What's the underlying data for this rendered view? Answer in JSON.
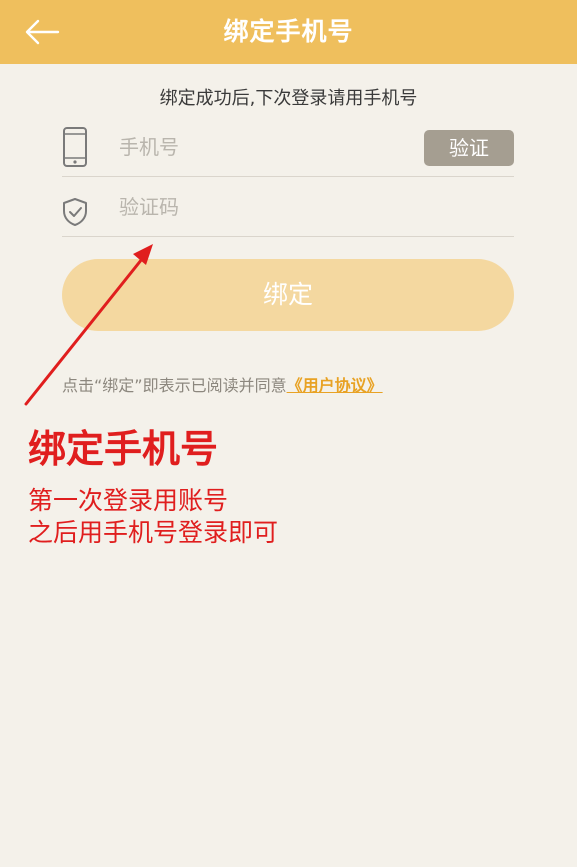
{
  "header": {
    "back_icon": "arrow-left-icon",
    "title": "绑定手机号",
    "color": "#efbf5d"
  },
  "subtitle": "绑定成功后,下次登录请用手机号",
  "form": {
    "phone": {
      "icon": "phone-icon",
      "placeholder": "手机号",
      "value": ""
    },
    "verify_button": "验证",
    "code": {
      "icon": "shield-check-icon",
      "placeholder": "验证码",
      "value": ""
    },
    "bind_button": "绑定"
  },
  "agreement": {
    "prefix": "点击“绑定”即表示已阅读并同意",
    "link": "《用户协议》",
    "link_color": "#e8a224"
  },
  "annotation": {
    "title": "绑定手机号",
    "line1": "第一次登录用账号",
    "line2": "之后用手机号登录即可",
    "color": "#e01e1e"
  }
}
